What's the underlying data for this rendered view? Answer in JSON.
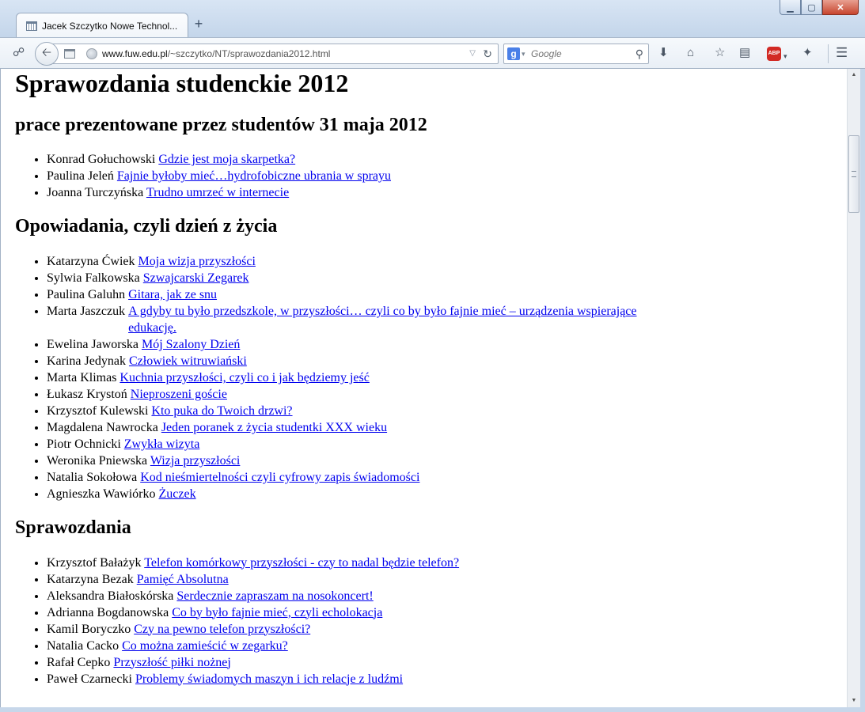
{
  "browser": {
    "tab_title": "Jacek Szczytko Nowe Technol...",
    "new_tab_label": "+",
    "url_host": "www.fuw.edu.pl",
    "url_path": "/~szczytko/NT/sprawozdania2012.html",
    "search_engine": "g",
    "search_placeholder": "Google",
    "abp_label": "ABP",
    "window_minimize": "▁",
    "window_maximize": "▢",
    "window_close": "✕",
    "icons": [
      "social-icon",
      "back-icon",
      "history-icon",
      "globe-icon",
      "reload-icon",
      "search-icon",
      "download-icon",
      "home-icon",
      "bookmark-star-icon",
      "reading-list-icon",
      "adblock-icon",
      "pocket-icon",
      "menu-icon"
    ]
  },
  "page": {
    "title": "Sprawozdania studenckie 2012",
    "sections": [
      {
        "heading": "prace prezentowane przez studentów 31 maja 2012",
        "items": [
          {
            "author": "Konrad Gołuchowski",
            "title": "Gdzie jest moja skarpetka?"
          },
          {
            "author": "Paulina Jeleń",
            "title": "Fajnie byłoby mieć…hydrofobiczne ubrania w sprayu"
          },
          {
            "author": "Joanna Turczyńska",
            "title": "Trudno umrzeć w internecie"
          }
        ]
      },
      {
        "heading": "Opowiadania, czyli dzień z życia",
        "items": [
          {
            "author": "Katarzyna Ćwiek",
            "title": "Moja wizja przyszłości"
          },
          {
            "author": "Sylwia Falkowska",
            "title": "Szwajcarski Zegarek"
          },
          {
            "author": "Paulina Galuhn",
            "title": "Gitara, jak ze snu"
          },
          {
            "author": "Marta Jaszczuk",
            "title": "A gdyby tu było przedszkole, w przyszłości… czyli co by było fajnie mieć – urządzenia wspierające edukację."
          },
          {
            "author": "Ewelina Jaworska",
            "title": "Mój Szalony Dzień"
          },
          {
            "author": "Karina Jedynak",
            "title": "Człowiek witruwiański"
          },
          {
            "author": "Marta Klimas",
            "title": "Kuchnia przyszłości, czyli co i jak będziemy jeść"
          },
          {
            "author": "Łukasz Krystoń",
            "title": "Nieproszeni goście"
          },
          {
            "author": "Krzysztof Kulewski",
            "title": "Kto puka do Twoich drzwi?"
          },
          {
            "author": "Magdalena Nawrocka",
            "title": "Jeden poranek z życia studentki XXX wieku"
          },
          {
            "author": "Piotr Ochnicki",
            "title": "Zwykła wizyta"
          },
          {
            "author": "Weronika Pniewska",
            "title": "Wizja przyszłości"
          },
          {
            "author": "Natalia Sokołowa",
            "title": "Kod nieśmiertelności czyli cyfrowy zapis świadomości"
          },
          {
            "author": "Agnieszka Wawiórko",
            "title": "Żuczek"
          }
        ]
      },
      {
        "heading": "Sprawozdania",
        "items": [
          {
            "author": "Krzysztof Bałażyk",
            "title": "Telefon komórkowy przyszłości - czy to nadal będzie telefon?"
          },
          {
            "author": "Katarzyna Bezak",
            "title": "Pamięć Absolutna"
          },
          {
            "author": "Aleksandra Białoskórska",
            "title": "Serdecznie zapraszam na nosokoncert!"
          },
          {
            "author": "Adrianna Bogdanowska",
            "title": "Co by było fajnie mieć, czyli echolokacja"
          },
          {
            "author": "Kamil Boryczko",
            "title": "Czy na pewno telefon przyszłości?"
          },
          {
            "author": "Natalia Cacko",
            "title": "Co można zamieścić w zegarku?"
          },
          {
            "author": "Rafał Cepko",
            "title": "Przyszłość piłki nożnej"
          },
          {
            "author": "Paweł Czarnecki",
            "title": "Problemy świadomych maszyn i ich relacje z ludźmi"
          }
        ]
      }
    ]
  }
}
